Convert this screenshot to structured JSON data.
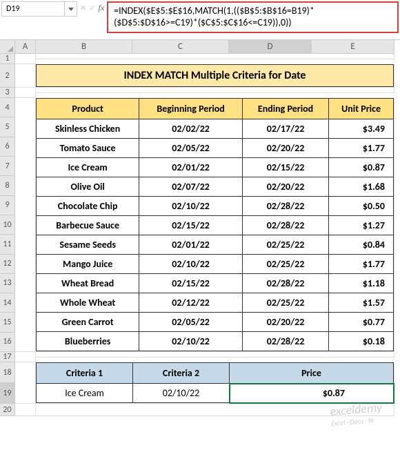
{
  "nameBox": "D19",
  "formula": "=INDEX($E$5:$E$16,MATCH(1,(($B$5:$B$16=B19)*($D$5:$D$16>=C19)*($C$5:$C$16<=C19)),0))",
  "columns": [
    "A",
    "B",
    "C",
    "D",
    "E"
  ],
  "title": "INDEX MATCH Multiple Criteria for Date",
  "headers": {
    "product": "Product",
    "begin": "Beginning Period",
    "end": "Ending Period",
    "price": "Unit Price"
  },
  "rows": [
    {
      "product": "Skinless Chicken",
      "begin": "02/02/22",
      "end": "02/17/22",
      "price": "$3.49"
    },
    {
      "product": "Tomato Sauce",
      "begin": "02/05/22",
      "end": "02/20/22",
      "price": "$1.77"
    },
    {
      "product": "Ice Cream",
      "begin": "02/01/22",
      "end": "02/15/22",
      "price": "$0.87"
    },
    {
      "product": "Olive Oil",
      "begin": "02/07/22",
      "end": "02/20/22",
      "price": "$1.68"
    },
    {
      "product": "Chocolate Chip",
      "begin": "02/10/22",
      "end": "02/28/22",
      "price": "$0.50"
    },
    {
      "product": "Barbecue Sauce",
      "begin": "02/15/22",
      "end": "02/28/22",
      "price": "$1.27"
    },
    {
      "product": "Sesame Seeds",
      "begin": "02/01/22",
      "end": "02/25/22",
      "price": "$0.84"
    },
    {
      "product": "Mango Juice",
      "begin": "02/10/22",
      "end": "02/25/22",
      "price": "$1.77"
    },
    {
      "product": "Wheat Bread",
      "begin": "02/15/22",
      "end": "02/28/22",
      "price": "$1.18"
    },
    {
      "product": "Whole Wheat",
      "begin": "02/12/22",
      "end": "02/25/22",
      "price": "$1.57"
    },
    {
      "product": "Green Carrot",
      "begin": "02/05/22",
      "end": "02/20/22",
      "price": "$0.77"
    },
    {
      "product": "Blueberries",
      "begin": "02/10/22",
      "end": "02/28/22",
      "price": "$0.18"
    }
  ],
  "criteriaHeaders": {
    "c1": "Criteria 1",
    "c2": "Criteria 2",
    "price": "Price"
  },
  "criteria": {
    "c1": "Ice Cream",
    "c2": "02/10/22",
    "price": "$0.87"
  },
  "watermark": {
    "main": "exceldemy",
    "sub": "Excel · Data · BI"
  }
}
